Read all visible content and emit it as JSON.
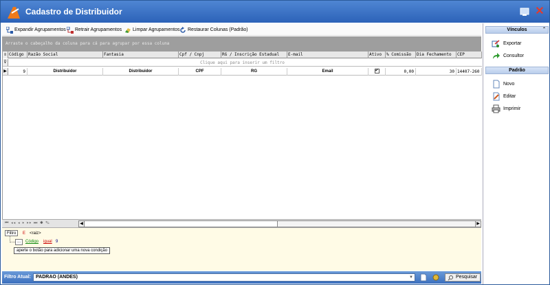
{
  "window": {
    "title": "Cadastro de Distribuidor"
  },
  "toolbar": {
    "expand": "Expandir Agrupamentos",
    "collapse": "Retrair Agrupamentos",
    "clear": "Limpar Agrupamentos",
    "restore": "Restaurar Colunas (Padrão)"
  },
  "grid": {
    "group_hint": "Arraste o cabeçalho da coluna para cá para agrupar por essa coluna",
    "filter_hint": "Clique aqui para inserir um filtro",
    "columns": [
      "Código",
      "Razão Social",
      "Fantasia",
      "Cpf / Cnpj",
      "RG / Inscrição Estadual",
      "E-mail",
      "Ativo",
      "% Comissão",
      "Dia Fechamento",
      "CEP"
    ],
    "row": {
      "codigo": "9",
      "razao": "Distribuidor",
      "fantasia": "Distribuidor",
      "cpf": "CPF",
      "rg": "RG",
      "email": "Email",
      "ativo": "✔",
      "comissao": "0,00",
      "fechamento": "30",
      "cep": "14407-260"
    }
  },
  "filter": {
    "label": "Filtro",
    "and": "E",
    "root": "<raiz>",
    "dots": "...",
    "field": "Código",
    "op": "igual",
    "value": "9",
    "tooltip": "aperte o botão para adicionar uma nova condição"
  },
  "status": {
    "label": "Filtro Atual:",
    "current": "PADRAO (ANDES)",
    "search": "Pesquisar"
  },
  "side": {
    "vinculos": "Vínculos",
    "exportar": "Exportar",
    "consultor": "Consultor",
    "padrao": "Padrão",
    "novo": "Novo",
    "editar": "Editar",
    "imprimir": "Imprimir"
  },
  "colors": {
    "title_bar": "#3a70c4",
    "group_panel": "#9e9e9e",
    "filter_bg": "#fffbe6",
    "close": "#e63a2a"
  }
}
